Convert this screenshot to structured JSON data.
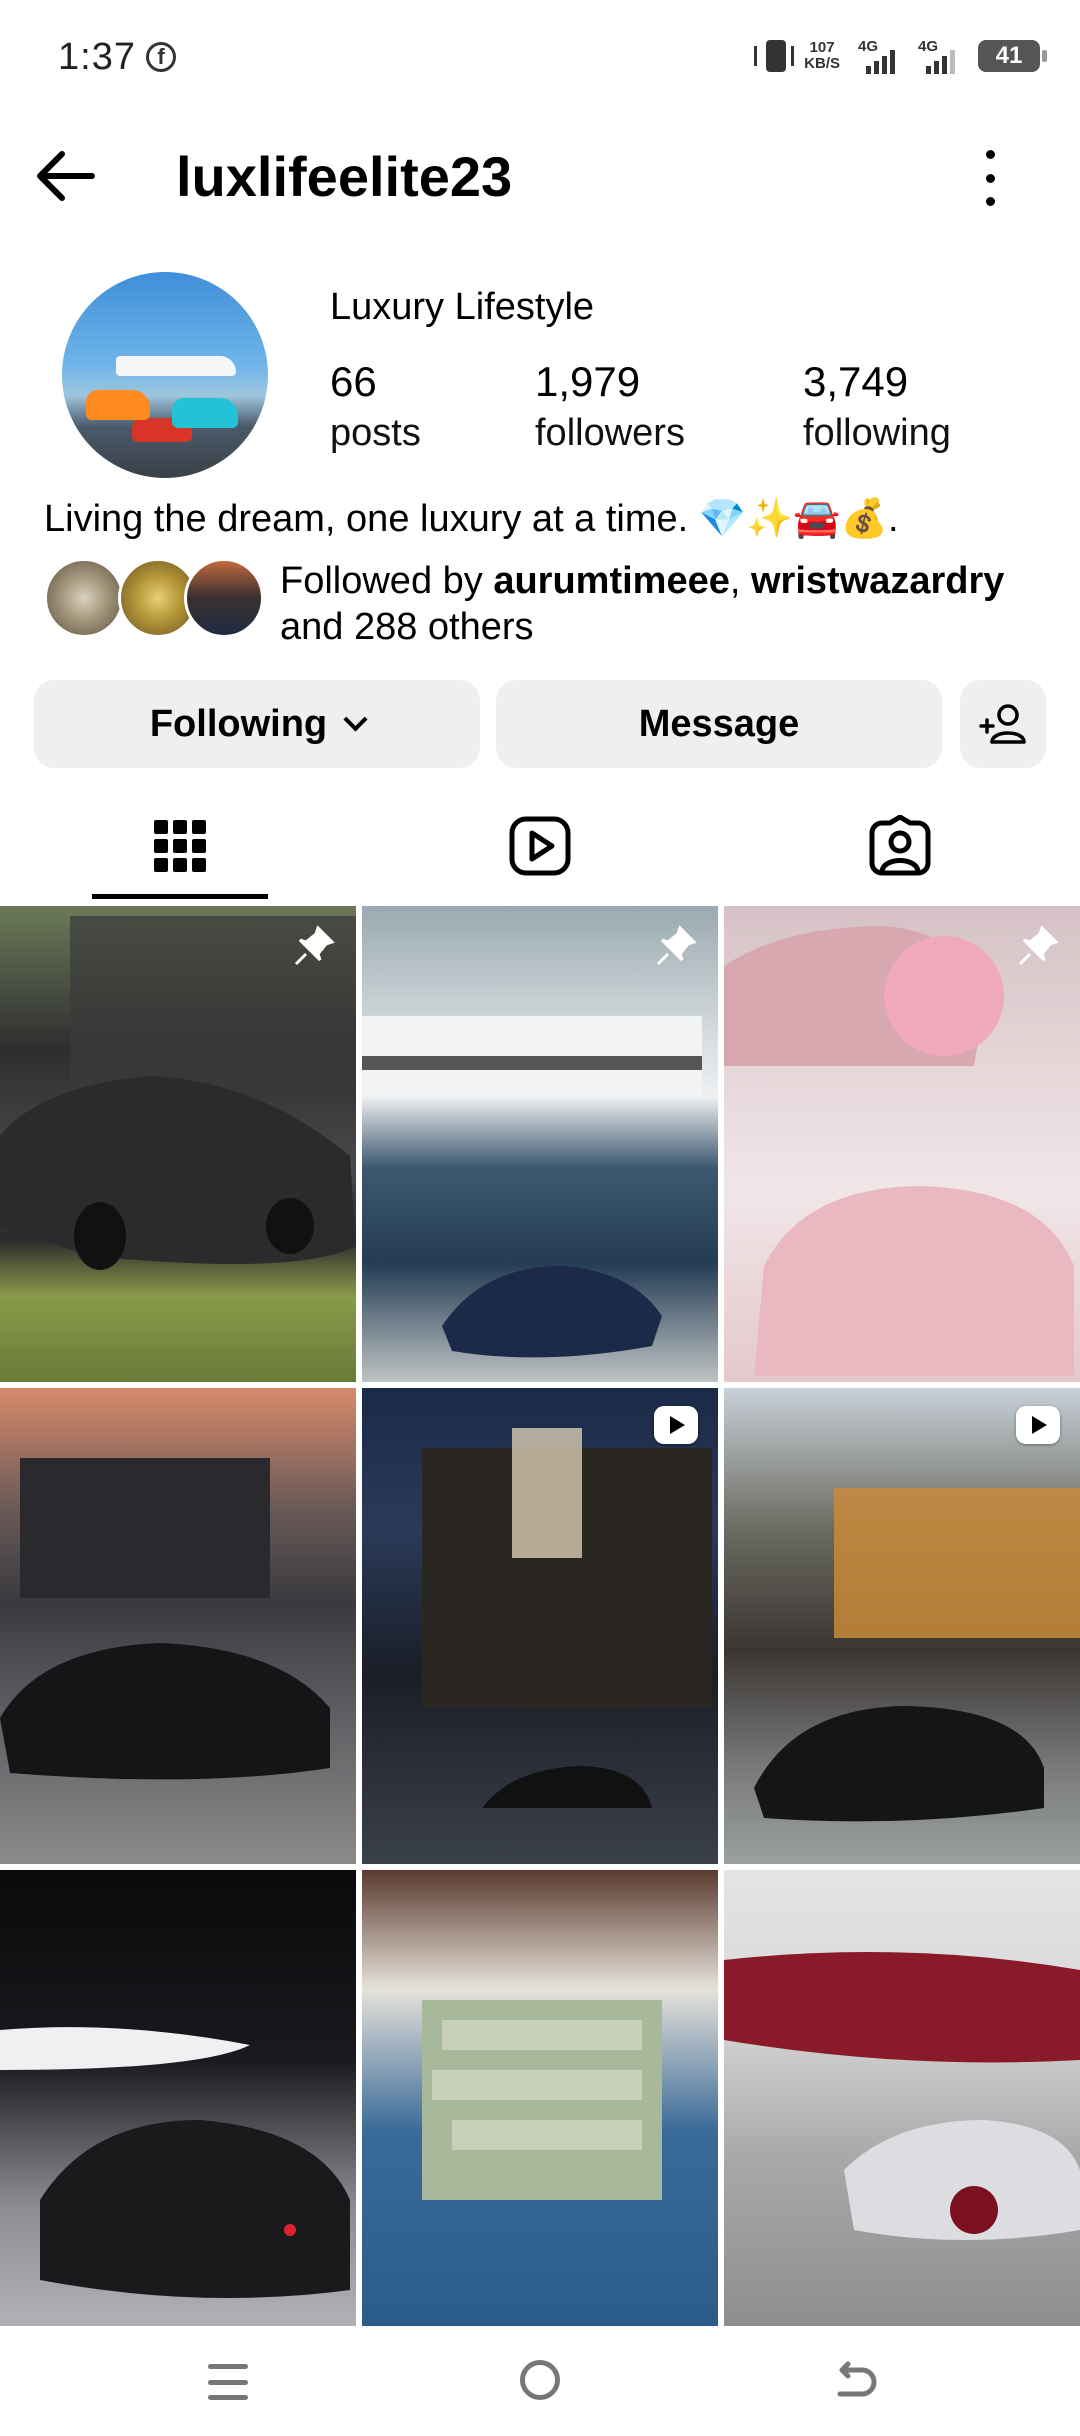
{
  "status_bar": {
    "time": "1:37",
    "notification_icon": "facebook-icon",
    "net_speed_value": "107",
    "net_speed_unit": "KB/S",
    "sim1_label": "4G",
    "sim2_label": "4G",
    "battery": "41"
  },
  "header": {
    "username": "luxlifeelite23"
  },
  "profile": {
    "display_name": "Luxury Lifestyle",
    "stats": [
      {
        "value": "66",
        "label": "posts"
      },
      {
        "value": "1,979",
        "label": "followers"
      },
      {
        "value": "3,749",
        "label": "following"
      }
    ],
    "bio": "Living the dream, one luxury at a time. 💎✨🚘💰.",
    "followed_by_prefix": "Followed by ",
    "followed_by_user1": "aurumtimeee",
    "followed_by_sep": ", ",
    "followed_by_user2": "wristwazardry",
    "followed_by_suffix": "and 288 others"
  },
  "actions": {
    "following_label": "Following",
    "message_label": "Message"
  },
  "tabs": [
    {
      "name": "posts-grid",
      "icon": "grid-icon",
      "active": true
    },
    {
      "name": "reels",
      "icon": "reels-icon",
      "active": false
    },
    {
      "name": "tagged",
      "icon": "tagged-user-icon",
      "active": false
    }
  ],
  "posts": [
    {
      "subject": "matte grey hypercar on lawn",
      "badge": "pin-icon"
    },
    {
      "subject": "superyacht with blue hypercar",
      "badge": "pin-icon"
    },
    {
      "subject": "pink sports cars with flowers",
      "badge": "pin-icon"
    },
    {
      "subject": "black supercar at modern house at sunset",
      "badge": ""
    },
    {
      "subject": "night villa with chandelier and hypercar",
      "badge": "reel-icon"
    },
    {
      "subject": "modern villa with hypercar",
      "badge": "reel-icon"
    },
    {
      "subject": "private jet and black supercar",
      "badge": ""
    },
    {
      "subject": "bag full of cash",
      "badge": ""
    },
    {
      "subject": "red private jet and red-white hypercar",
      "badge": ""
    }
  ],
  "colors": {
    "button_bg": "#efefef",
    "text": "#000000",
    "nav_icon": "#777777"
  }
}
